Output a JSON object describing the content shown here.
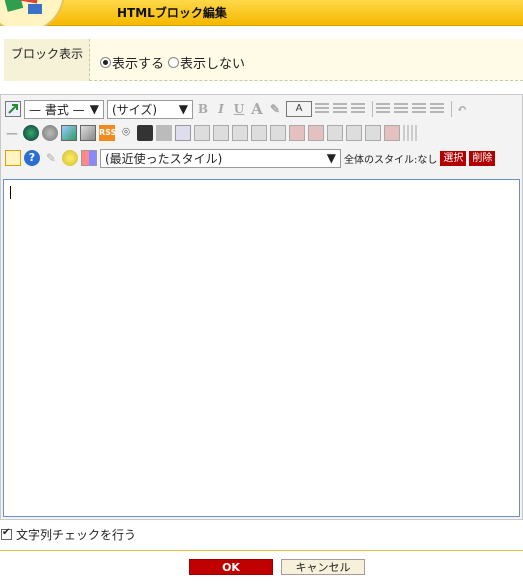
{
  "header": {
    "title": "HTMLブロック編集"
  },
  "block_display": {
    "label": "ブロック表示",
    "options": [
      {
        "label": "表示する",
        "selected": true
      },
      {
        "label": "表示しない",
        "selected": false
      }
    ]
  },
  "toolbar": {
    "format_select": "— 書式 —",
    "size_select": "(サイズ)",
    "style_select": "(最近使ったスタイル)",
    "overall_style_label": "全体のスタイル:なし",
    "select_button": "選択",
    "delete_button": "削除",
    "rss_label": "RSS"
  },
  "editor": {
    "content": ""
  },
  "check_text": {
    "label": "文字列チェックを行う",
    "checked": true
  },
  "actions": {
    "ok": "OK",
    "cancel": "キャンセル"
  },
  "colors": {
    "accent": "#f5b800",
    "danger": "#c00000",
    "panel": "#fffbe6"
  }
}
